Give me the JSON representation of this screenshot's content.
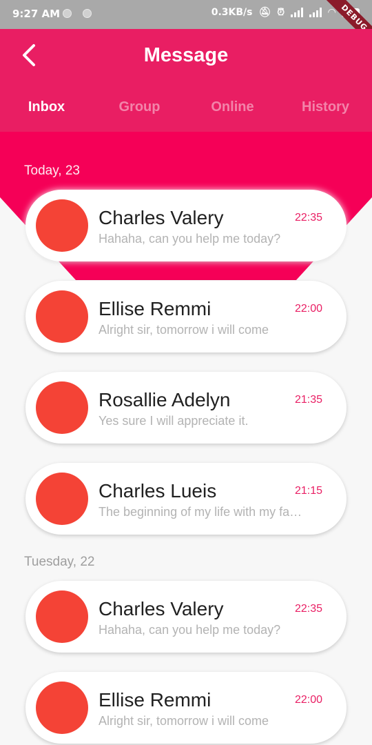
{
  "status_bar": {
    "time": "9:27 AM",
    "network_speed": "0.3KB/s",
    "battery": "40",
    "debug_label": "DEBUG"
  },
  "header": {
    "title": "Message",
    "back_icon": "chevron-left-icon"
  },
  "tabs": [
    {
      "label": "Inbox",
      "active": true
    },
    {
      "label": "Group",
      "active": false
    },
    {
      "label": "Online",
      "active": false
    },
    {
      "label": "History",
      "active": false
    }
  ],
  "colors": {
    "primary": "#e91e63",
    "accent_strong": "#f50057",
    "avatar": "#f44336",
    "time_text": "#e91e63"
  },
  "sections": [
    {
      "label": "Today, 23",
      "messages": [
        {
          "name": "Charles Valery",
          "preview": "Hahaha, can you help me today?",
          "time": "22:35"
        },
        {
          "name": "Ellise Remmi",
          "preview": "Alright sir, tomorrow i will come",
          "time": "22:00"
        },
        {
          "name": "Rosallie Adelyn",
          "preview": "Yes sure I will appreciate it.",
          "time": "21:35"
        },
        {
          "name": "Charles Lueis",
          "preview": "The beginning of my life with my family",
          "time": "21:15"
        }
      ]
    },
    {
      "label": "Tuesday, 22",
      "messages": [
        {
          "name": "Charles Valery",
          "preview": "Hahaha, can you help me today?",
          "time": "22:35"
        },
        {
          "name": "Ellise Remmi",
          "preview": "Alright sir, tomorrow i will come",
          "time": "22:00"
        }
      ]
    }
  ]
}
